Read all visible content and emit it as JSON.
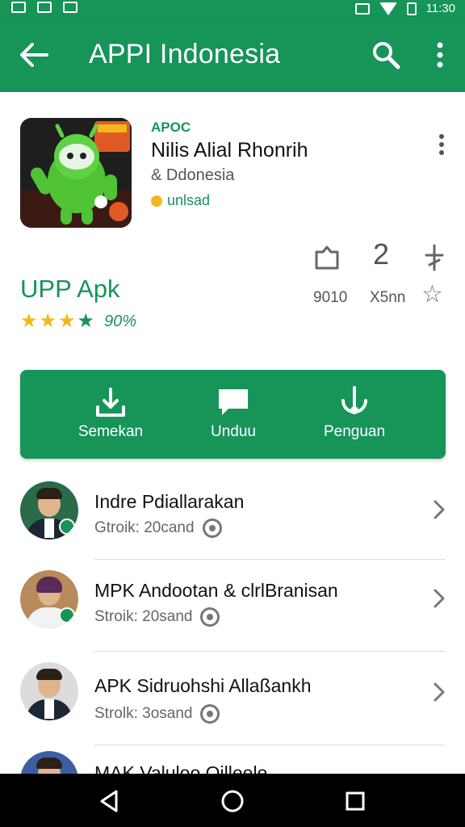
{
  "status_bar": {
    "time": "11:30"
  },
  "app_bar": {
    "title": "APPI Indonesia"
  },
  "app": {
    "developer_tag": "APOC",
    "name": "Nilis Alial Rhonrih",
    "subtitle": "& Ddonesia",
    "badge": "unlsad",
    "brand_title": "UPP Apk",
    "rating_percent": "90%",
    "stars_filled": 4,
    "stats": {
      "share_value": "9010",
      "count_number": "2",
      "count_label": "X5nn"
    }
  },
  "actions": [
    {
      "label": "Semekan",
      "icon": "download-box-icon"
    },
    {
      "label": "Unduu",
      "icon": "chat-bubble-icon"
    },
    {
      "label": "Penguan",
      "icon": "touch-icon"
    }
  ],
  "list": {
    "items": [
      {
        "title": "Indre Pdiallarakan",
        "meta": "Gtroik: 20cand"
      },
      {
        "title": "MPK Andootan & clrlBranisan",
        "meta": "Stroik: 20sand"
      },
      {
        "title": "APK Sidruohshi Allaßankh",
        "meta": "Strolk: 3osand"
      },
      {
        "title": "MAK Valuloo Oilleele",
        "meta": ""
      }
    ]
  },
  "colors": {
    "primary": "#179457",
    "star": "#f2b81b"
  }
}
